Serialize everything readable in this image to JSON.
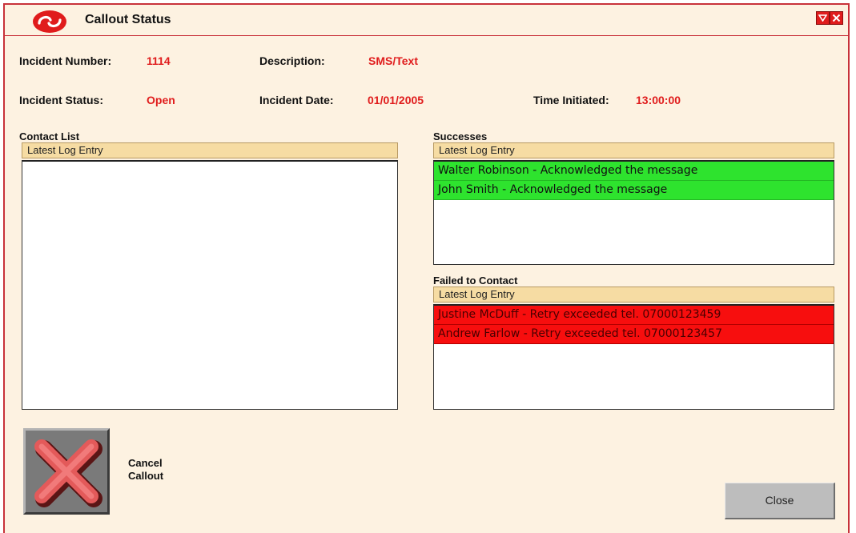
{
  "window": {
    "title": "Callout Status"
  },
  "incident": {
    "number_label": "Incident Number:",
    "number": "1114",
    "description_label": "Description:",
    "description": "SMS/Text",
    "status_label": "Incident Status:",
    "status": "Open",
    "date_label": "Incident Date:",
    "date": "01/01/2005",
    "time_label": "Time Initiated:",
    "time": "13:00:00"
  },
  "contact_list": {
    "title": "Contact List",
    "column": "Latest Log Entry",
    "rows": []
  },
  "successes": {
    "title": "Successes",
    "column": "Latest Log Entry",
    "rows": [
      "Walter Robinson - Acknowledged the message",
      "John Smith - Acknowledged the message"
    ]
  },
  "failed": {
    "title": "Failed to Contact",
    "column": "Latest Log Entry",
    "rows": [
      "Justine McDuff - Retry exceeded tel. 07000123459",
      "Andrew Farlow - Retry exceeded tel. 07000123457"
    ]
  },
  "actions": {
    "cancel_line1": "Cancel",
    "cancel_line2": "Callout",
    "close": "Close"
  },
  "icons": {
    "logo": "app-logo-icon",
    "minimize": "triangle-down-icon",
    "close": "close-x-icon",
    "cancel": "red-x-icon"
  },
  "colors": {
    "accent": "#e01c1c",
    "background": "#fdf2e1",
    "success_row": "#2ee32e",
    "failed_row": "#f70e0e",
    "column_header": "#f6dca3"
  }
}
